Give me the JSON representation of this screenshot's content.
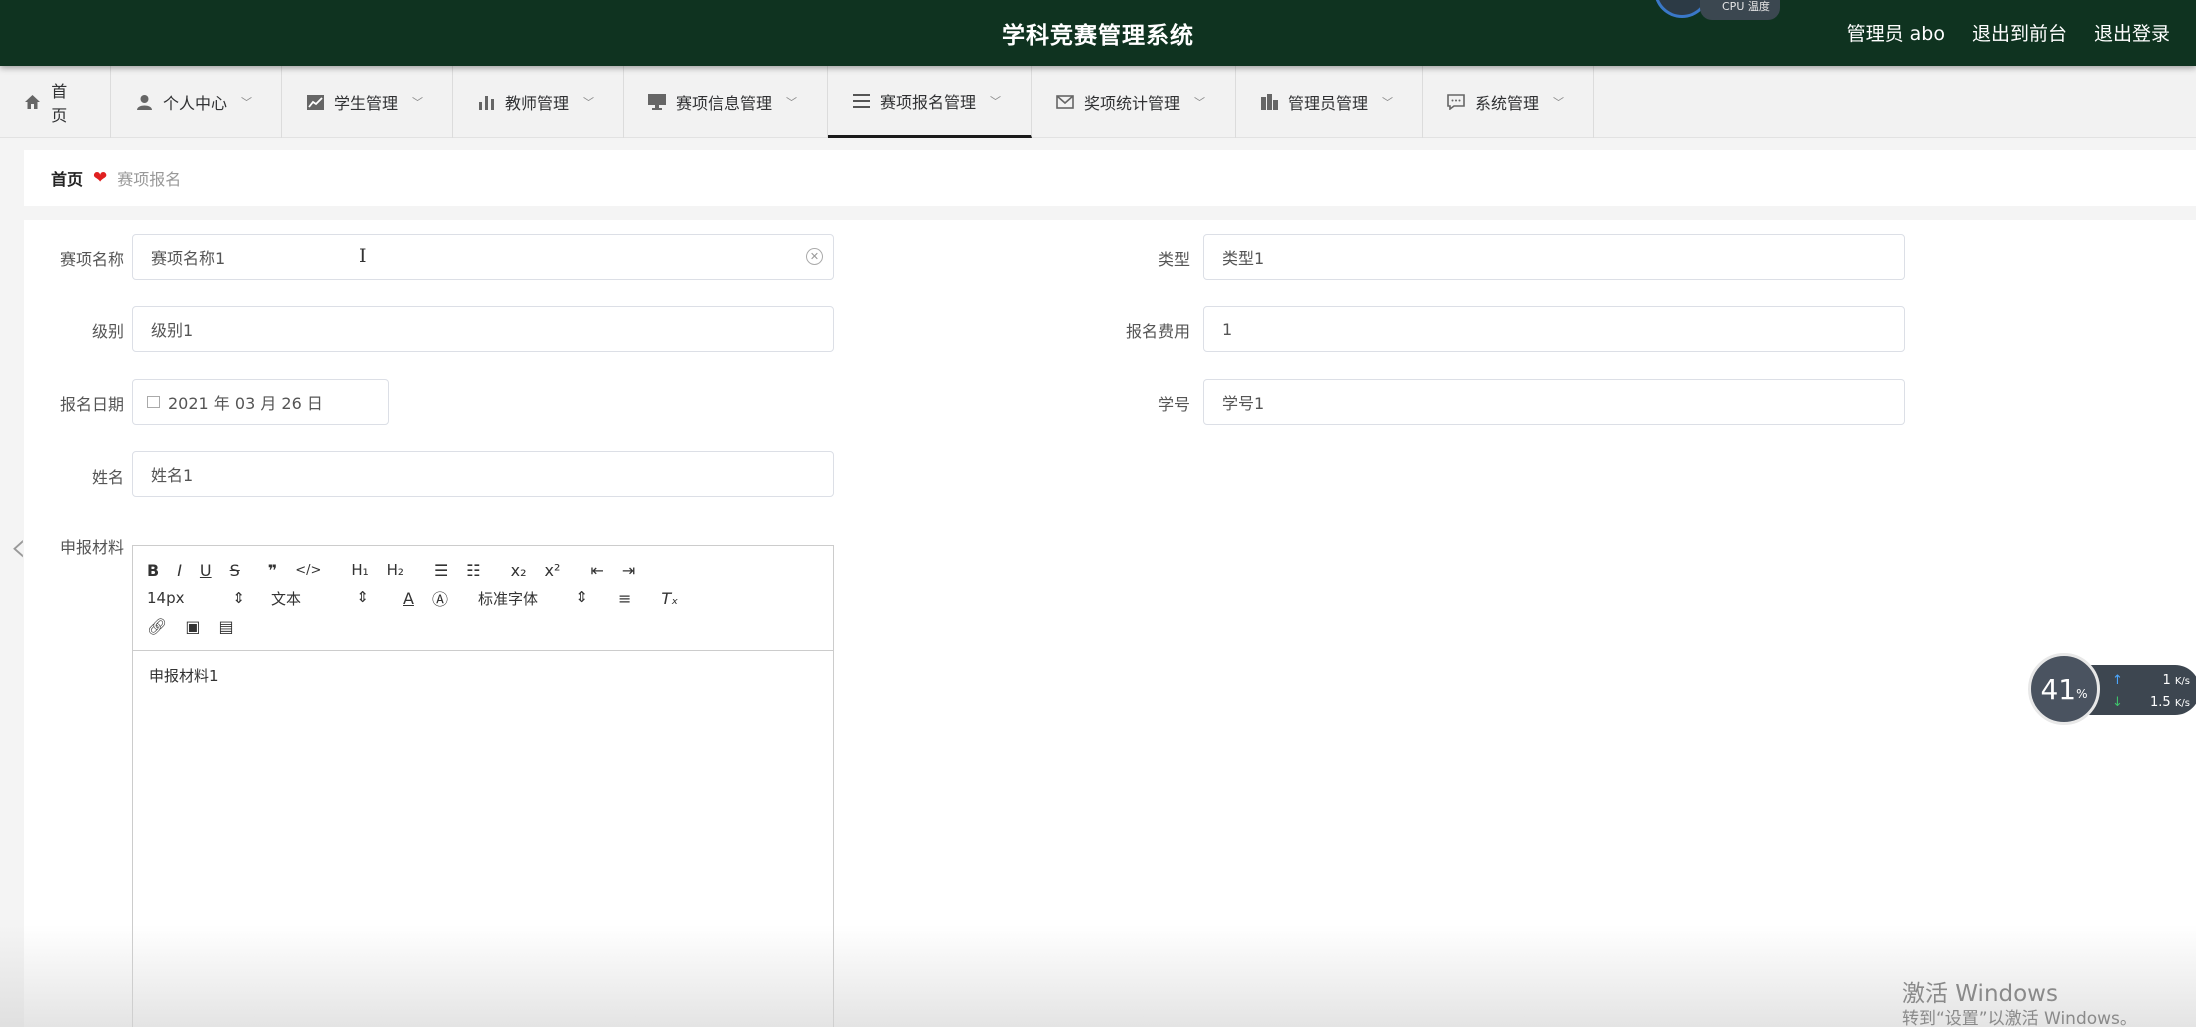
{
  "header": {
    "title": "学科竞赛管理系统",
    "links": [
      "管理员 abo",
      "退出到前台",
      "退出登录"
    ],
    "cpu_label": "CPU 温度"
  },
  "nav": [
    {
      "label": "首页",
      "icon": "home-icon"
    },
    {
      "label": "个人中心",
      "icon": "user-icon"
    },
    {
      "label": "学生管理",
      "icon": "chart-icon"
    },
    {
      "label": "教师管理",
      "icon": "bar-chart-icon"
    },
    {
      "label": "赛项信息管理",
      "icon": "monitor-icon"
    },
    {
      "label": "赛项报名管理",
      "icon": "list-icon",
      "active": true
    },
    {
      "label": "奖项统计管理",
      "icon": "mail-icon"
    },
    {
      "label": "管理员管理",
      "icon": "building-icon"
    },
    {
      "label": "系统管理",
      "icon": "chat-icon"
    }
  ],
  "breadcrumb": {
    "home": "首页",
    "current": "赛项报名"
  },
  "form": {
    "name_label": "赛项名称",
    "name_value": "赛项名称1",
    "type_label": "类型",
    "type_value": "类型1",
    "level_label": "级别",
    "level_value": "级别1",
    "fee_label": "报名费用",
    "fee_value": "1",
    "date_label": "报名日期",
    "date_value": "2021 年 03 月 26 日",
    "student_id_label": "学号",
    "student_id_value": "学号1",
    "student_name_label": "姓名",
    "student_name_value": "姓名1",
    "material_label": "申报材料"
  },
  "editor": {
    "size_option": "14px",
    "format_option": "文本",
    "font_option": "标准字体",
    "content": "申报材料1"
  },
  "speed": {
    "percent": "41",
    "percent_unit": "%",
    "up": "1",
    "up_unit": "K/s",
    "down": "1.5",
    "down_unit": "K/s"
  },
  "watermark": {
    "line1": "激活 Windows",
    "line2": "转到“设置”以激活 Windows。"
  },
  "colors": {
    "header_bg": "#0f3320",
    "accent_red": "#e02020"
  }
}
